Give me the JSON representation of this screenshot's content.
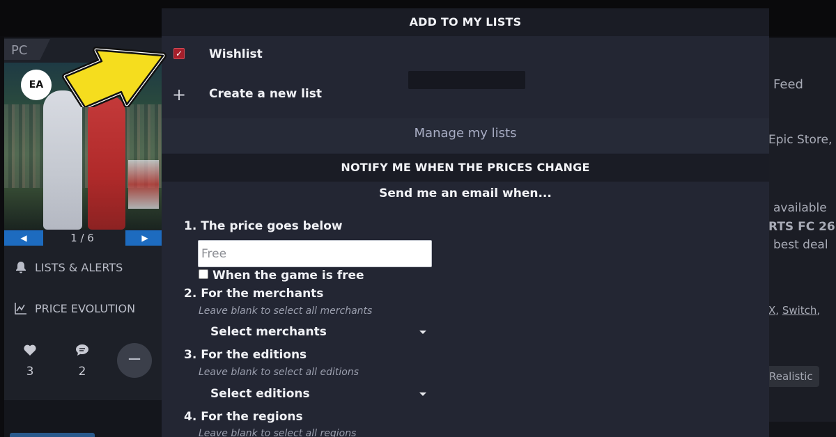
{
  "background": {
    "platform_tag": "PC",
    "logo_text": "EA",
    "pager": {
      "count": "1 / 6"
    },
    "side_links": {
      "lists_alerts": "LISTS & ALERTS",
      "price_evolution": "PRICE EVOLUTION"
    },
    "stats": {
      "likes": "3",
      "comments": "2"
    },
    "collapse_glyph": "−",
    "right_column": {
      "feed": "Feed",
      "line1": "Epic Store,",
      "line2": "available",
      "line3": "RTS FC 26",
      "line4": "best deal",
      "platforms_x": "X",
      "platforms_switch": "Switch",
      "tag_realistic": "Realistic"
    }
  },
  "modal": {
    "lists_header": "ADD TO MY LISTS",
    "wishlist_label": "Wishlist",
    "wishlist_checked": true,
    "create_list_label": "Create a new list",
    "manage_label": "Manage my lists",
    "notify_header": "NOTIFY ME WHEN THE PRICES CHANGE",
    "form_title": "Send me an email when...",
    "q1_label": "1. The price goes below",
    "price_placeholder": "Free",
    "free_checkbox_label": "When the game is free",
    "q2_label": "2. For the merchants",
    "q2_hint": "Leave blank to select all merchants",
    "merchants_select": "Select merchants",
    "q3_label": "3. For the editions",
    "q3_hint": "Leave blank to select all editions",
    "editions_select": "Select editions",
    "q4_label": "4. For the regions",
    "q4_hint": "Leave blank to select all regions"
  },
  "colors": {
    "modal_bg": "#232633",
    "header_bg": "#1a1c25",
    "checkbox_red": "#a51f2b",
    "arrow_yellow": "#f5dd1e",
    "pager_blue": "#1d6bbf"
  }
}
